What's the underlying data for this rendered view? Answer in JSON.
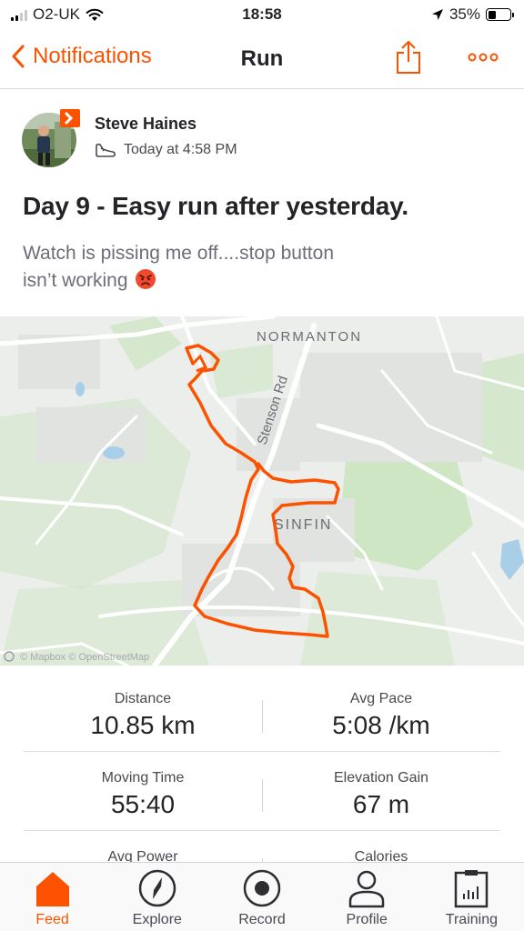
{
  "status_bar": {
    "carrier": "O2-UK",
    "time": "18:58",
    "battery": "35%",
    "battery_level": 0.35
  },
  "nav": {
    "back_label": "Notifications",
    "title": "Run",
    "icons": [
      "chevron-left-icon",
      "share-icon",
      "more-icon"
    ]
  },
  "activity": {
    "athlete_name": "Steve Haines",
    "timestamp": "Today at 4:58 PM",
    "activity_icon": "shoe-icon",
    "title": "Day 9 - Easy run after yesterday.",
    "description_line1": "Watch is pissing me off....stop button",
    "description_line2": "isn’t working",
    "description_emoji": "angry-face-emoji"
  },
  "map": {
    "labels": [
      "NORMANTON",
      "Stenson Rd",
      "SINFIN"
    ],
    "attribution": "© Mapbox © OpenStreetMap",
    "route_color": "#fc5200"
  },
  "stats": {
    "rows": [
      {
        "left_label": "Distance",
        "left_value": "10.85 km",
        "right_label": "Avg Pace",
        "right_value": "5:08 /km"
      },
      {
        "left_label": "Moving Time",
        "left_value": "55:40",
        "right_label": "Elevation Gain",
        "right_value": "67 m"
      },
      {
        "left_label": "Avg Power",
        "right_label": "Calories"
      }
    ]
  },
  "tabs": [
    {
      "label": "Feed",
      "icon": "home-icon",
      "active": true
    },
    {
      "label": "Explore",
      "icon": "compass-icon",
      "active": false
    },
    {
      "label": "Record",
      "icon": "record-icon",
      "active": false
    },
    {
      "label": "Profile",
      "icon": "profile-icon",
      "active": false
    },
    {
      "label": "Training",
      "icon": "training-icon",
      "active": false
    }
  ],
  "colors": {
    "accent": "#fc5200",
    "text": "#242428",
    "secondary_text": "#6d6d78"
  }
}
